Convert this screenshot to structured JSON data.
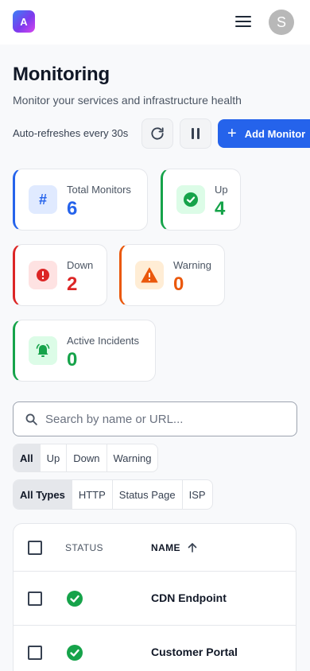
{
  "header": {
    "logo_letter": "A",
    "avatar_letter": "S"
  },
  "page": {
    "title": "Monitoring",
    "subtitle": "Monitor your services and infrastructure health",
    "refresh_text": "Auto-refreshes every 30s",
    "add_button": "Add Monitor"
  },
  "stats": {
    "total": {
      "label": "Total Monitors",
      "value": "6",
      "color": "#2563eb"
    },
    "up": {
      "label": "Up",
      "value": "4",
      "color": "#16a34a"
    },
    "down": {
      "label": "Down",
      "value": "2",
      "color": "#dc2626"
    },
    "warning": {
      "label": "Warning",
      "value": "0",
      "color": "#ea580c"
    },
    "incidents": {
      "label": "Active Incidents",
      "value": "0",
      "color": "#16a34a"
    }
  },
  "search": {
    "placeholder": "Search by name or URL...",
    "value": ""
  },
  "status_filter": {
    "options": [
      "All",
      "Up",
      "Down",
      "Warning"
    ],
    "selected": "All"
  },
  "type_filter": {
    "options": [
      "All Types",
      "HTTP",
      "Status Page",
      "ISP"
    ],
    "selected": "All Types"
  },
  "table": {
    "columns": {
      "status": "STATUS",
      "name": "NAME"
    },
    "sort": "name-ascending",
    "rows": [
      {
        "name": "CDN Endpoint",
        "status": "up"
      },
      {
        "name": "Customer Portal",
        "status": "up"
      }
    ]
  },
  "icons": {
    "menu": "hamburger-menu-icon",
    "refresh": "refresh-icon",
    "pause": "pause-icon",
    "add": "plus-icon",
    "search": "search-icon",
    "sort": "arrow-up-icon"
  }
}
